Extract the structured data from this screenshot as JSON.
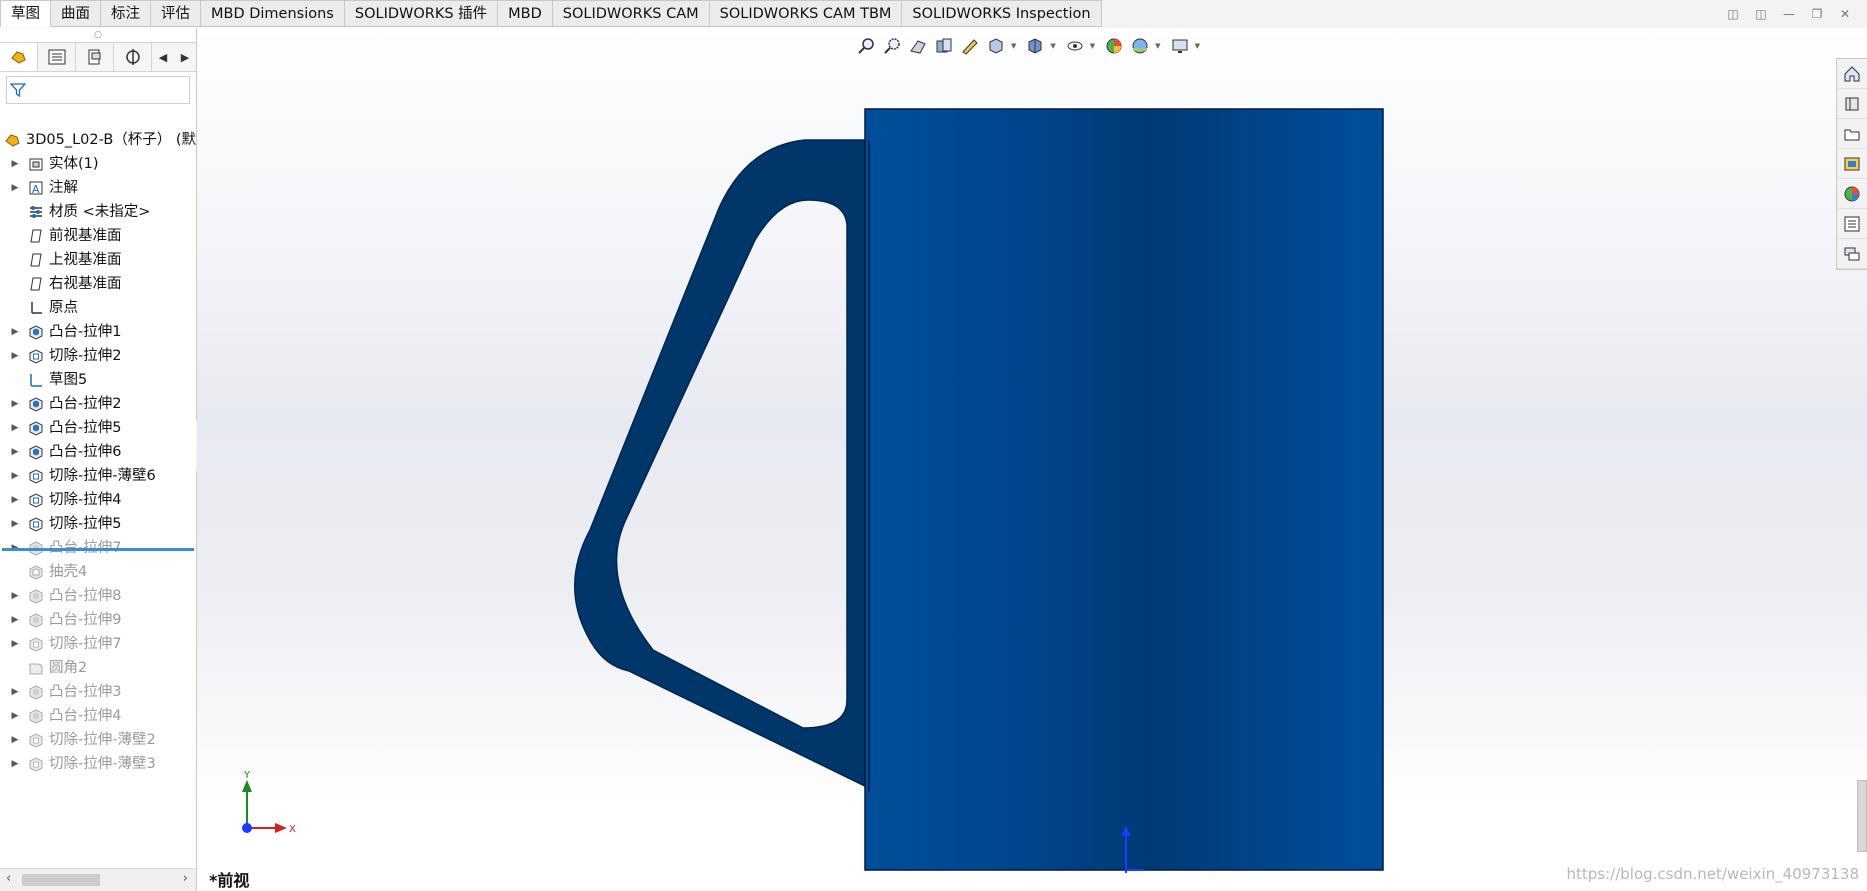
{
  "command_tabs": [
    {
      "label": "草图",
      "active": true
    },
    {
      "label": "曲面"
    },
    {
      "label": "标注"
    },
    {
      "label": "评估"
    },
    {
      "label": "MBD Dimensions"
    },
    {
      "label": "SOLIDWORKS 插件"
    },
    {
      "label": "MBD"
    },
    {
      "label": "SOLIDWORKS CAM"
    },
    {
      "label": "SOLIDWORKS CAM TBM"
    },
    {
      "label": "SOLIDWORKS Inspection"
    }
  ],
  "window_controls": [
    "restore-left-icon",
    "restore-right-icon",
    "minimize-icon",
    "maximize-icon",
    "close-icon"
  ],
  "feature_manager": {
    "panel_tabs": [
      "feature-manager-icon",
      "property-manager-icon",
      "configuration-manager-icon",
      "dimxpert-icon"
    ],
    "root": "3D05_L02-B（杯子） (默",
    "items": [
      {
        "label": "实体(1)",
        "icon": "solid-bodies-icon",
        "expand": true
      },
      {
        "label": "注解",
        "icon": "annotations-icon",
        "expand": true
      },
      {
        "label": "材质 <未指定>",
        "icon": "material-icon",
        "expand": false
      },
      {
        "label": "前视基准面",
        "icon": "plane-icon",
        "expand": false
      },
      {
        "label": "上视基准面",
        "icon": "plane-icon",
        "expand": false
      },
      {
        "label": "右视基准面",
        "icon": "plane-icon",
        "expand": false
      },
      {
        "label": "原点",
        "icon": "origin-icon",
        "expand": false
      },
      {
        "label": "凸台-拉伸1",
        "icon": "boss-extrude-icon",
        "expand": true
      },
      {
        "label": "切除-拉伸2",
        "icon": "cut-extrude-icon",
        "expand": true
      },
      {
        "label": "草图5",
        "icon": "sketch-icon",
        "expand": false
      },
      {
        "label": "凸台-拉伸2",
        "icon": "boss-extrude-icon",
        "expand": true
      },
      {
        "label": "凸台-拉伸5",
        "icon": "boss-extrude-icon",
        "expand": true
      },
      {
        "label": "凸台-拉伸6",
        "icon": "boss-extrude-icon",
        "expand": true
      },
      {
        "label": "切除-拉伸-薄壁6",
        "icon": "cut-extrude-icon",
        "expand": true
      },
      {
        "label": "切除-拉伸4",
        "icon": "cut-extrude-icon",
        "expand": true
      },
      {
        "label": "切除-拉伸5",
        "icon": "cut-extrude-icon",
        "expand": true
      },
      {
        "label": "凸台-拉伸7",
        "icon": "boss-extrude-icon",
        "expand": true,
        "suppressed": true
      },
      {
        "label": "抽壳4",
        "icon": "shell-icon",
        "expand": false,
        "suppressed": true
      },
      {
        "label": "凸台-拉伸8",
        "icon": "boss-extrude-icon",
        "expand": true,
        "suppressed": true
      },
      {
        "label": "凸台-拉伸9",
        "icon": "boss-extrude-icon",
        "expand": true,
        "suppressed": true
      },
      {
        "label": "切除-拉伸7",
        "icon": "cut-extrude-icon",
        "expand": true,
        "suppressed": true
      },
      {
        "label": "圆角2",
        "icon": "fillet-icon",
        "expand": false,
        "suppressed": true
      },
      {
        "label": "凸台-拉伸3",
        "icon": "boss-extrude-icon",
        "expand": true,
        "suppressed": true
      },
      {
        "label": "凸台-拉伸4",
        "icon": "boss-extrude-icon",
        "expand": true,
        "suppressed": true
      },
      {
        "label": "切除-拉伸-薄壁2",
        "icon": "cut-extrude-icon",
        "expand": true,
        "suppressed": true
      },
      {
        "label": "切除-拉伸-薄壁3",
        "icon": "cut-extrude-icon",
        "expand": true,
        "suppressed": true
      }
    ]
  },
  "heads_up_toolbar": [
    "zoom-to-fit-icon",
    "zoom-to-area-icon",
    "previous-view-icon",
    "section-view-icon",
    "dynamic-annotation-icon",
    "view-orientation-icon",
    "display-style-icon",
    "hide-show-icon",
    "edit-appearance-icon",
    "apply-scene-icon",
    "view-settings-icon"
  ],
  "task_pane": [
    "home-icon",
    "design-library-icon",
    "file-explorer-icon",
    "view-palette-icon",
    "appearances-icon",
    "custom-properties-icon",
    "forum-icon"
  ],
  "viewport": {
    "view_name": "*前视",
    "triad": {
      "x": "X",
      "y": "Y"
    },
    "watermark": "https://blog.csdn.net/weixin_40973138",
    "part_color": "#003a75"
  }
}
